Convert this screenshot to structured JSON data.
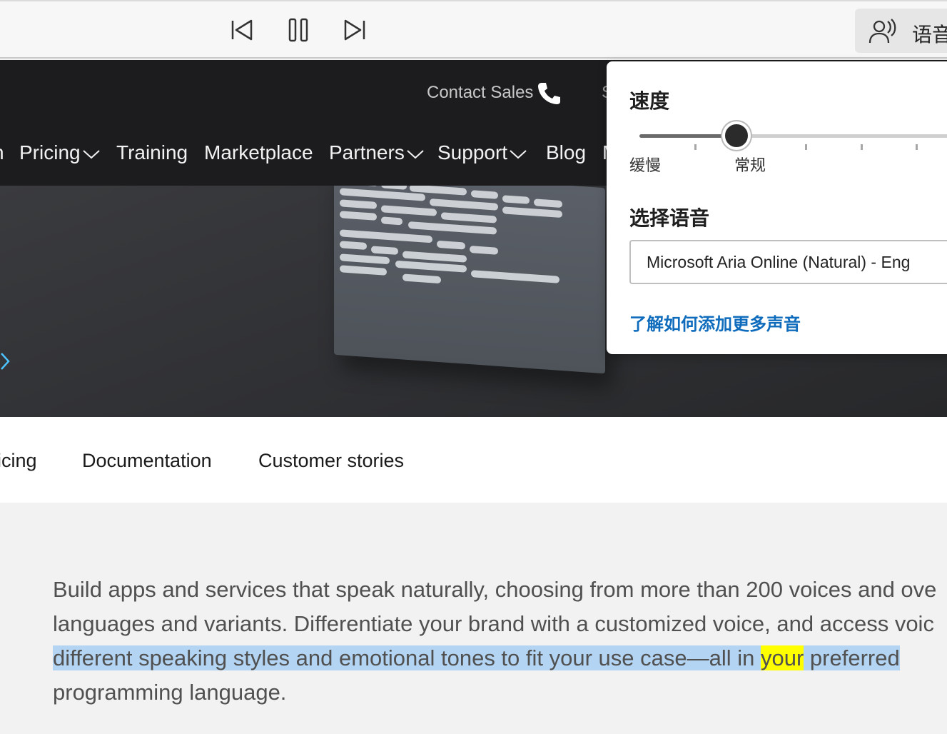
{
  "toolbar": {
    "prev_icon": "skip-previous-icon",
    "pause_icon": "pause-icon",
    "next_icon": "skip-next-icon",
    "voice_options_icon": "voice-options-icon",
    "voice_options_label": "语音"
  },
  "header": {
    "contact_sales": "Contact Sales",
    "phone_icon": "phone-icon",
    "sliver_text": "S",
    "nav": [
      {
        "label": "n"
      },
      {
        "label": "Pricing"
      },
      {
        "label": "Training"
      },
      {
        "label": "Marketplace"
      },
      {
        "label": "Partners"
      },
      {
        "label": "Support"
      },
      {
        "label": "Blog"
      },
      {
        "label": "M"
      }
    ]
  },
  "hero": {
    "arrow_icon": "chevron-right-icon"
  },
  "subnav": {
    "items": [
      "icing",
      "Documentation",
      "Customer stories"
    ]
  },
  "content": {
    "line1": "Build apps and services that speak naturally, choosing from more than 200 voices and ove",
    "line2": "languages and variants. Differentiate your brand with a customized voice, and access voic",
    "line3_a": "different speaking styles and emotional tones to fit your use case—all in ",
    "line3_word": "your",
    "line3_b": " preferred",
    "line4": "programming language."
  },
  "popup": {
    "speed_title": "速度",
    "speed_value": 0.25,
    "speed_labels": {
      "slow": "缓慢",
      "normal": "常规"
    },
    "voice_title": "选择语音",
    "selected_voice": "Microsoft Aria Online (Natural) - Eng",
    "more_voices_link": "了解如何添加更多声音"
  },
  "colors": {
    "header_bg": "#1c1c1f",
    "link_blue": "#0f6cbd",
    "selection_highlight": "#b3d4f2",
    "word_highlight": "#ffff00"
  }
}
